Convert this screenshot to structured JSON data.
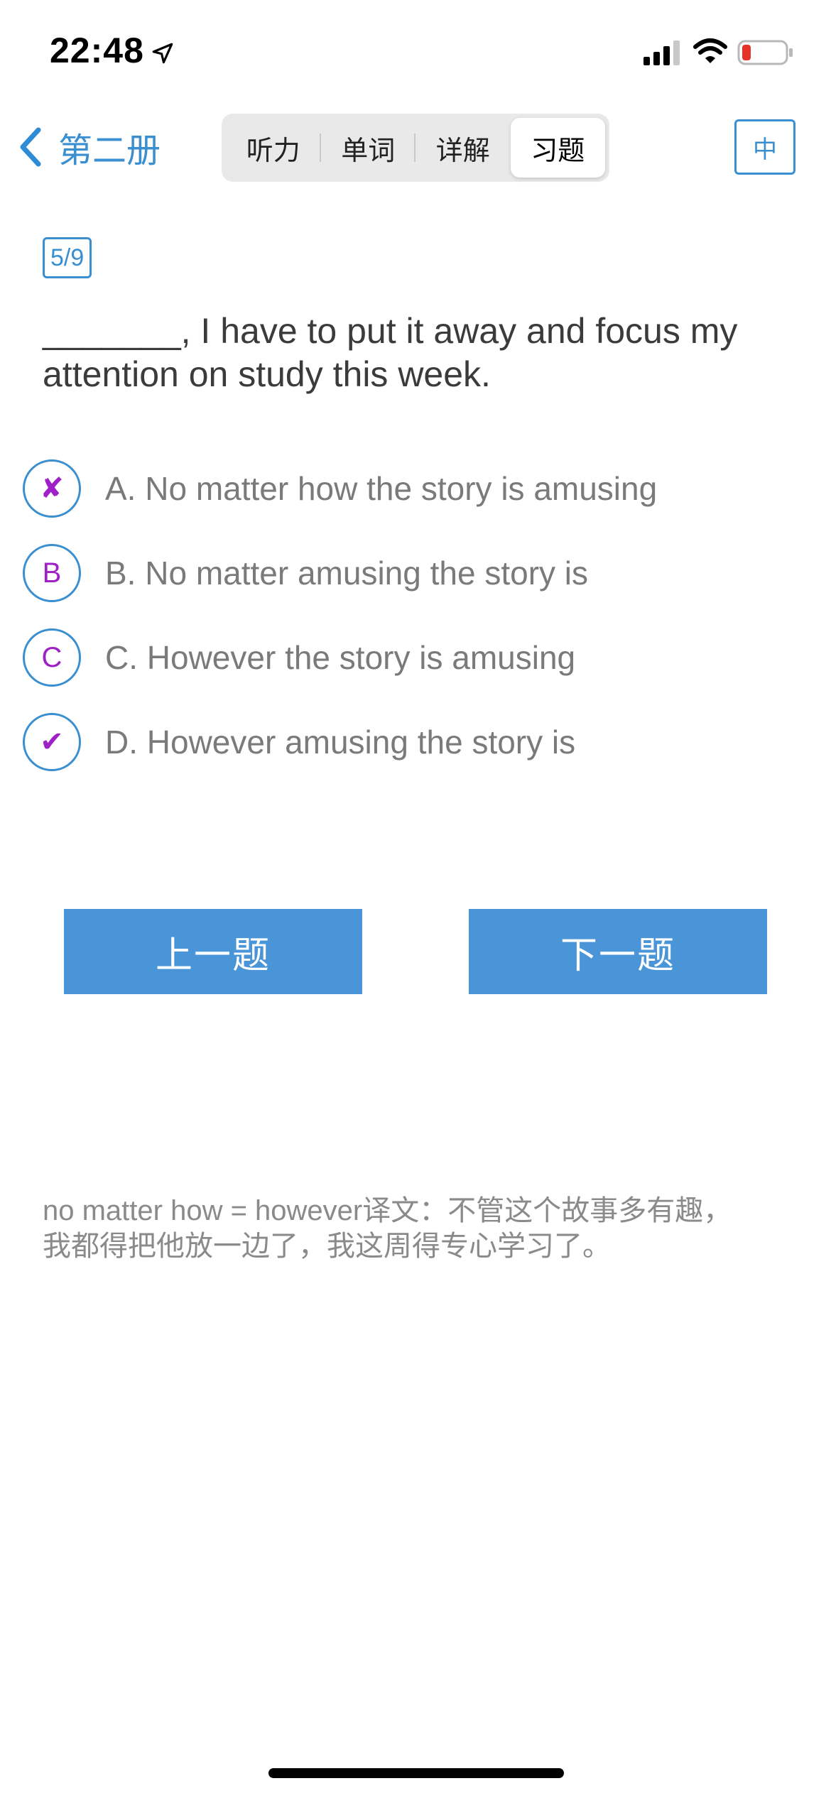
{
  "status_bar": {
    "time": "22:48",
    "icons": [
      "location-arrow-icon",
      "signal-icon",
      "wifi-icon",
      "battery-low-icon"
    ],
    "battery_color": "#e5332a"
  },
  "nav": {
    "back_label": "第二册",
    "tabs": [
      {
        "label": "听力",
        "active": false
      },
      {
        "label": "单词",
        "active": false
      },
      {
        "label": "详解",
        "active": false
      },
      {
        "label": "习题",
        "active": true
      }
    ],
    "lang_toggle": "中"
  },
  "quiz": {
    "progress": "5/9",
    "question": "_______, I have to put it away and focus my attention on study this week.",
    "options": [
      {
        "marker": "✘",
        "text": "A. No matter how the story is amusing",
        "state": "wrong"
      },
      {
        "marker": "B",
        "text": "B. No matter amusing the story is",
        "state": "none"
      },
      {
        "marker": "C",
        "text": "C. However the story is amusing",
        "state": "none"
      },
      {
        "marker": "✔",
        "text": "D. However amusing the story is",
        "state": "correct"
      }
    ],
    "prev_label": "上一题",
    "next_label": "下一题",
    "explanation": "no matter how = however译文：不管这个故事多有趣，我都得把他放一边了，我这周得专心学习了。"
  },
  "colors": {
    "accent": "#3a8fd0",
    "button": "#4a95d8",
    "marker": "#a020c8"
  }
}
